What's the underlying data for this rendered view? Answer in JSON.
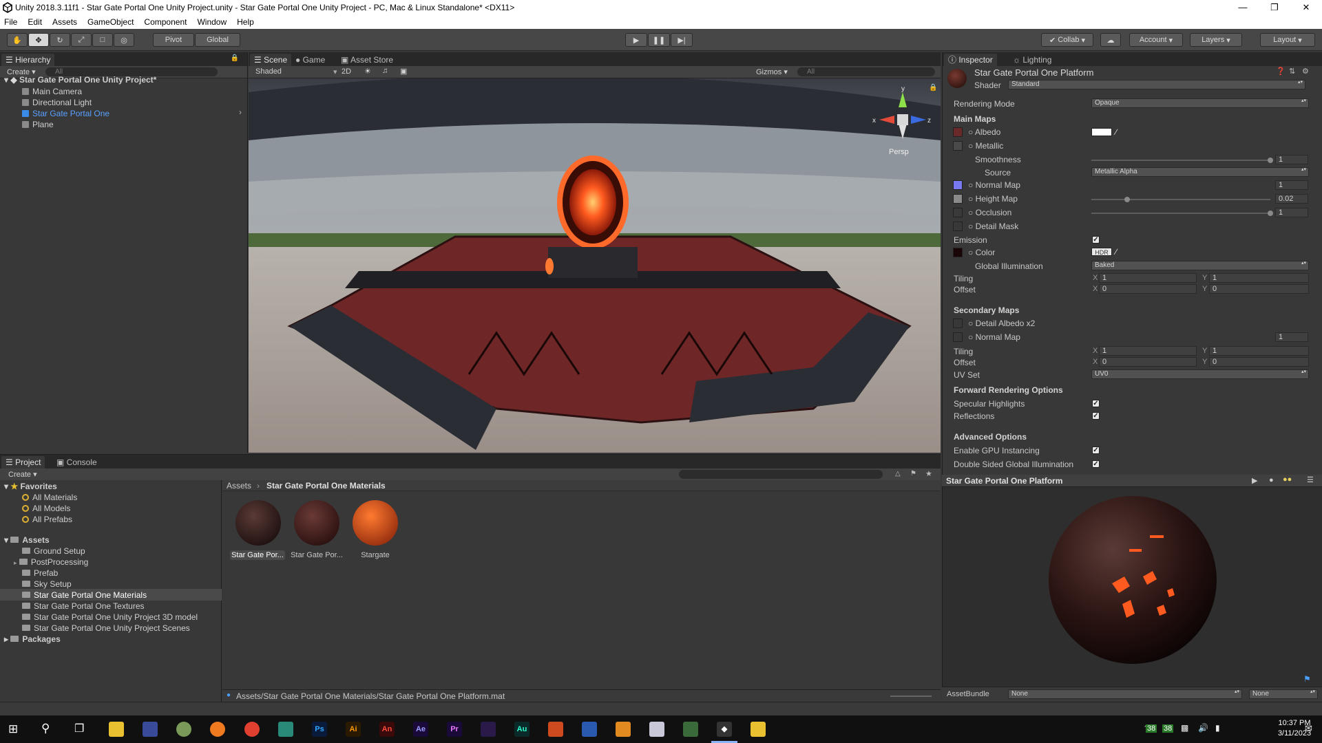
{
  "window": {
    "title": "Unity 2018.3.11f1 - Star Gate Portal One Unity Project.unity - Star Gate Portal One Unity Project - PC, Mac & Linux Standalone* <DX11>"
  },
  "menu": [
    "File",
    "Edit",
    "Assets",
    "GameObject",
    "Component",
    "Window",
    "Help"
  ],
  "toolbar": {
    "pivot": "Pivot",
    "global": "Global",
    "collab": "Collab",
    "account": "Account",
    "layers": "Layers",
    "layout": "Layout"
  },
  "hierarchy": {
    "tab": "Hierarchy",
    "create": "Create",
    "search_placeholder": "All",
    "root": "Star Gate Portal One Unity Project*",
    "items": [
      "Main Camera",
      "Directional Light",
      "Star Gate Portal One",
      "Plane"
    ],
    "selected_index": 2
  },
  "scene": {
    "tabs": [
      "Scene",
      "Game",
      "Asset Store"
    ],
    "shading": "Shaded",
    "mode_2d": "2D",
    "gizmos": "Gizmos",
    "search_placeholder": "All",
    "persp": "Persp",
    "axis_y": "y",
    "axis_x": "x",
    "axis_z": "z"
  },
  "inspector": {
    "tabs": [
      "Inspector",
      "Lighting"
    ],
    "material_name": "Star Gate Portal One Platform",
    "shader_label": "Shader",
    "shader_value": "Standard",
    "rendering_mode_label": "Rendering Mode",
    "rendering_mode_value": "Opaque",
    "main_maps": "Main Maps",
    "albedo": "Albedo",
    "metallic": "Metallic",
    "smoothness": "Smoothness",
    "smoothness_value": "1",
    "smoothness_level": 1.0,
    "source": "Source",
    "source_value": "Metallic Alpha",
    "normal_map": "Normal Map",
    "normal_map_value": "1",
    "height_map": "Height Map",
    "height_map_value": "0.02",
    "height_map_level": 0.2,
    "occlusion": "Occlusion",
    "occlusion_value": "1",
    "occlusion_level": 1.0,
    "detail_mask": "Detail Mask",
    "emission": "Emission",
    "emission_checked": true,
    "color": "Color",
    "hdr": "HDR",
    "global_illumination": "Global Illumination",
    "gi_value": "Baked",
    "tiling": "Tiling",
    "offset": "Offset",
    "x": "X",
    "y": "Y",
    "tiling_x": "1",
    "tiling_y": "1",
    "offset_x": "0",
    "offset_y": "0",
    "secondary_maps": "Secondary Maps",
    "detail_albedo": "Detail Albedo x2",
    "sec_normal_map": "Normal Map",
    "sec_normal_value": "1",
    "sec_tiling_x": "1",
    "sec_tiling_y": "1",
    "sec_offset_x": "0",
    "sec_offset_y": "0",
    "uv_set": "UV Set",
    "uv_set_value": "UV0",
    "forward_rendering": "Forward Rendering Options",
    "specular_highlights": "Specular Highlights",
    "reflections": "Reflections",
    "advanced_options": "Advanced Options",
    "gpu_instancing": "Enable GPU Instancing",
    "double_sided_gi": "Double Sided Global Illumination",
    "preview_title": "Star Gate Portal One Platform",
    "assetbundle_label": "AssetBundle",
    "assetbundle_value": "None",
    "assetbundle_variant": "None"
  },
  "project": {
    "tabs": [
      "Project",
      "Console"
    ],
    "create": "Create",
    "favorites": "Favorites",
    "favorite_items": [
      "All Materials",
      "All Models",
      "All Prefabs"
    ],
    "assets": "Assets",
    "asset_folders": [
      "Ground Setup",
      "PostProcessing",
      "Prefab",
      "Sky Setup",
      "Star Gate Portal One Materials",
      "Star Gate Portal One Textures",
      "Star Gate Portal One Unity Project 3D model",
      "Star Gate Portal One Unity Project Scenes"
    ],
    "selected_folder_index": 4,
    "packages": "Packages",
    "breadcrumb_root": "Assets",
    "breadcrumb_current": "Star Gate Portal One Materials",
    "materials": [
      "Star Gate Por...",
      "Star Gate Por...",
      "Stargate"
    ],
    "path": "Assets/Star Gate Portal One Materials/Star Gate Portal One Platform.mat"
  },
  "taskbar": {
    "time": "10:37 PM",
    "date": "3/11/2023",
    "tray_nums": [
      "38",
      "38"
    ],
    "apps": [
      "Ps",
      "Ai",
      "An",
      "Ae",
      "Pr",
      "Au"
    ]
  },
  "colors": {
    "accent_blue": "#3a8be8",
    "portal_orange": "#ff5a1f",
    "platform_red": "#7a2a2a"
  }
}
